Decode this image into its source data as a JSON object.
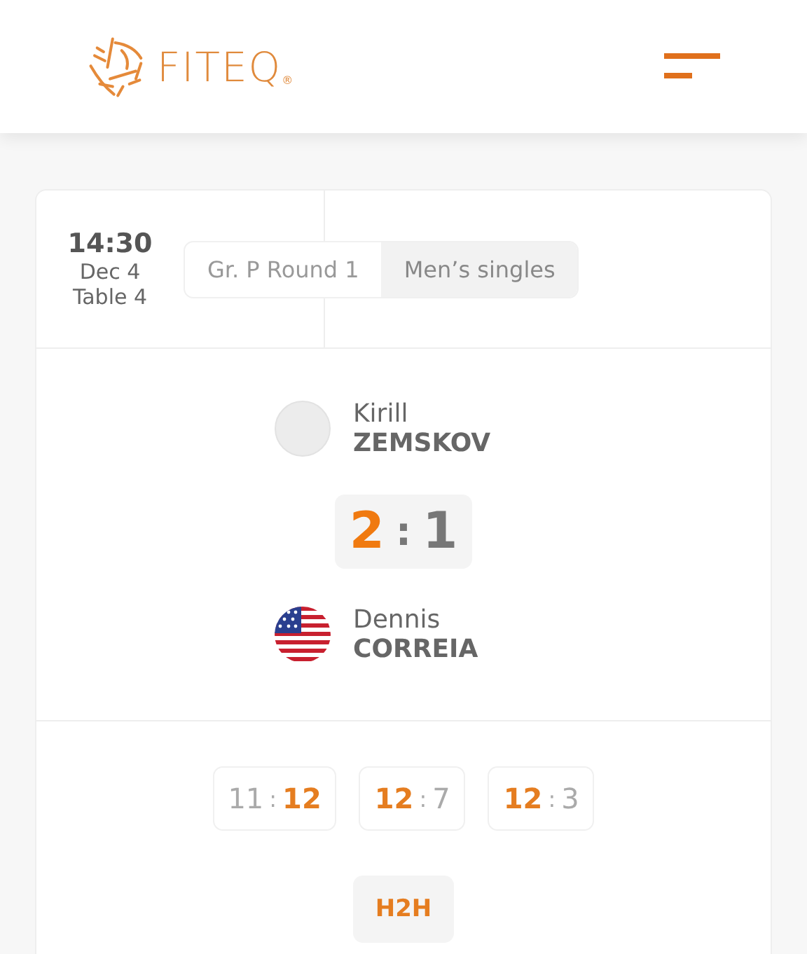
{
  "header": {
    "logo_text": "FITEQ",
    "logo_mark": "®"
  },
  "match": {
    "time": "14:30",
    "date": "Dec 4",
    "table": "Table 4",
    "tags": [
      {
        "label": "Gr. P Round 1",
        "selected": false
      },
      {
        "label": "Men’s singles",
        "selected": true
      }
    ],
    "players": [
      {
        "first": "Kirill",
        "last": "ZEMSKOV",
        "kind": "placeholder"
      },
      {
        "first": "Dennis",
        "last": "CORREIA",
        "kind": "flag"
      }
    ],
    "score": {
      "home": "2",
      "separator": ":",
      "away": "1",
      "home_won": true
    },
    "games": [
      {
        "home": "11",
        "separator": ":",
        "away": "12",
        "home_won": false
      },
      {
        "home": "12",
        "separator": ":",
        "away": "7",
        "home_won": true
      },
      {
        "home": "12",
        "separator": ":",
        "away": "3",
        "home_won": true
      }
    ],
    "h2h": "H2H"
  }
}
